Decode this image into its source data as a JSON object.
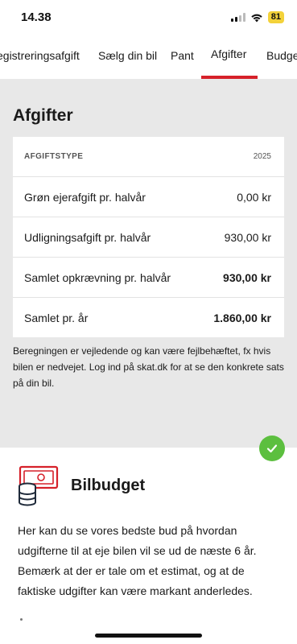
{
  "status_bar": {
    "time": "14.38",
    "battery": "81"
  },
  "tabs": [
    {
      "label": "egistreringsafgift"
    },
    {
      "label": "Sælg din bil"
    },
    {
      "label": "Pant"
    },
    {
      "label": "Afgifter",
      "active": true
    },
    {
      "label": "Budge"
    }
  ],
  "fees": {
    "title": "Afgifter",
    "header": {
      "type_label": "AFGIFTSTYPE",
      "year": "2025"
    },
    "rows": [
      {
        "label": "Grøn ejerafgift pr. halvår",
        "value": "0,00 kr"
      },
      {
        "label": "Udligningsafgift pr. halvår",
        "value": "930,00 kr"
      },
      {
        "label": "Samlet opkrævning pr. halvår",
        "value": "930,00 kr"
      },
      {
        "label": "Samlet pr. år",
        "value": "1.860,00 kr"
      }
    ],
    "disclaimer": "Beregningen er vejledende og kan være fejlbehæftet, fx hvis bilen er nedvejet. Log ind på skat.dk for at se den konkrete sats på din bil."
  },
  "budget": {
    "title": "Bilbudget",
    "text": "Her kan du se vores bedste bud på hvordan udgifterne til at eje bilen vil se ud de næste 6 år. Bemærk at der er tale om et estimat, og at de faktiske udgifter kan være markant anderledes."
  },
  "colors": {
    "accent": "#d6212a",
    "badge": "#5cbf3f",
    "section_bg": "#e8e8e8"
  }
}
